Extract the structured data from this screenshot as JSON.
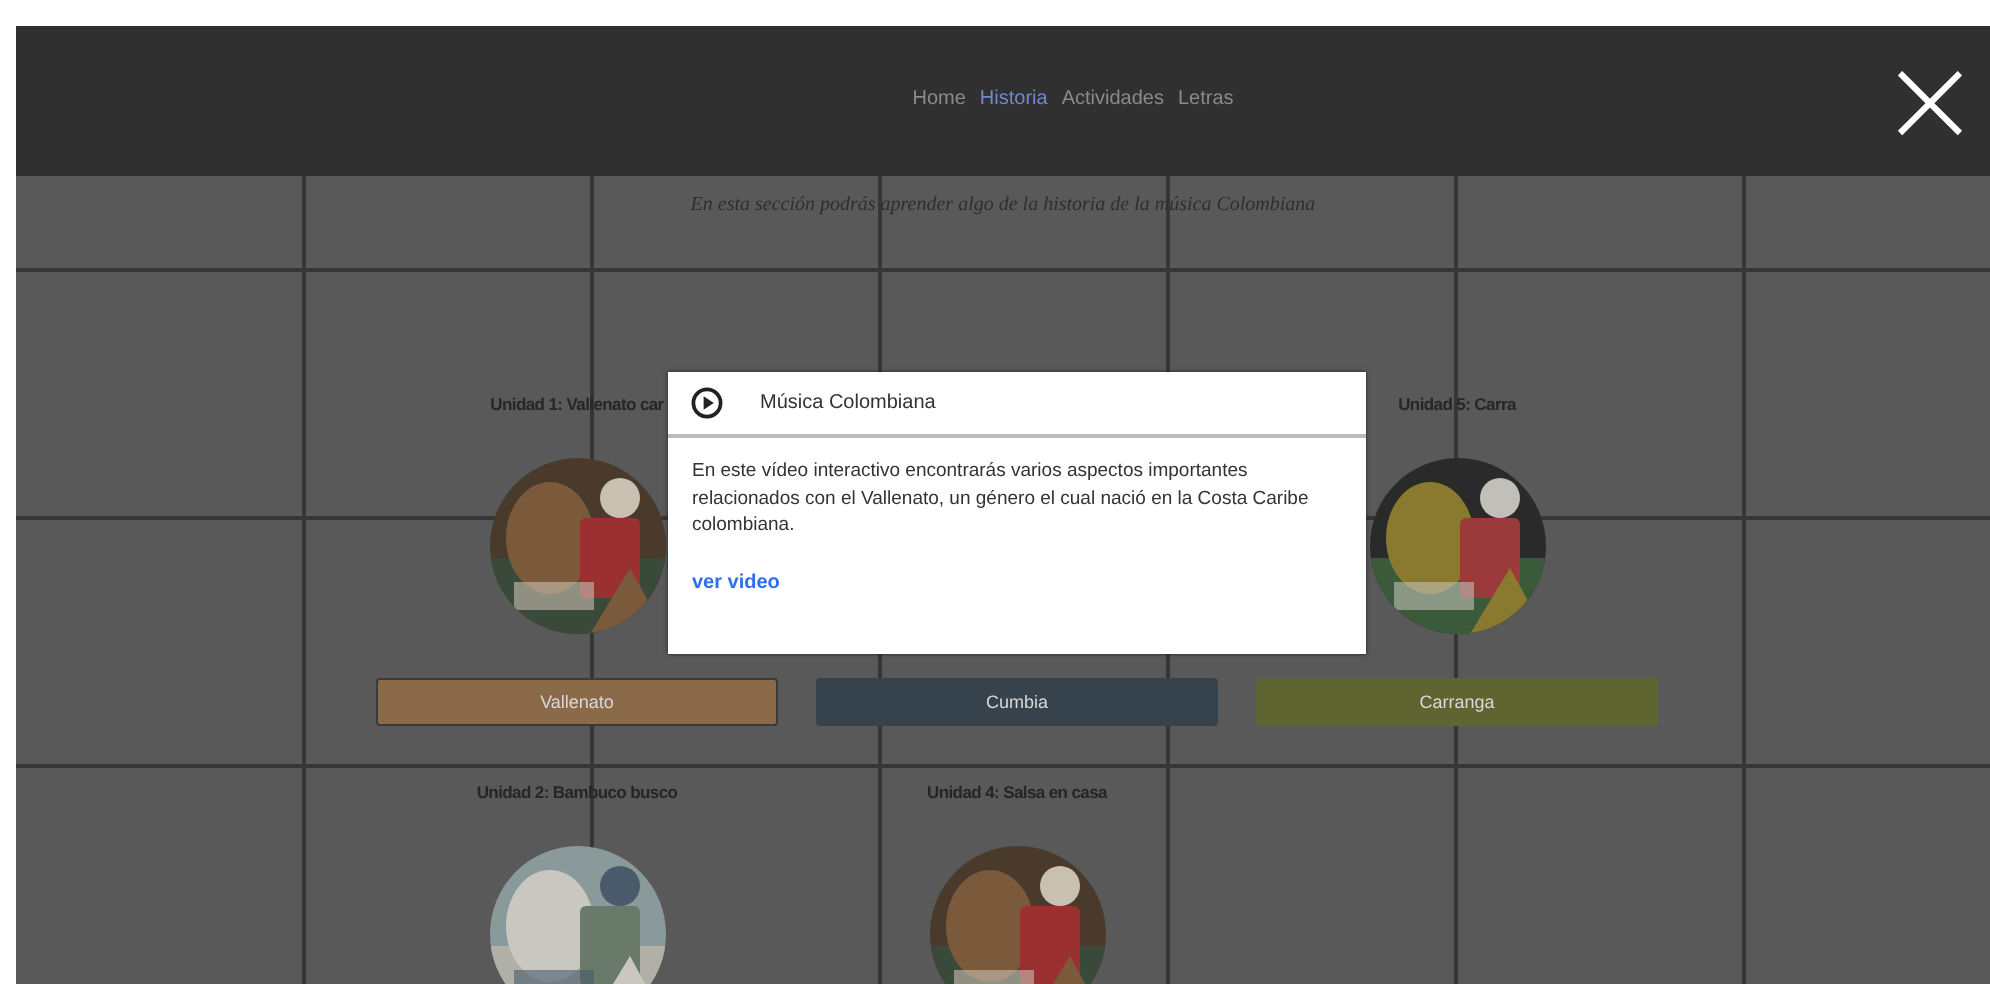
{
  "nav": {
    "items": [
      {
        "label": "Home",
        "selected": false
      },
      {
        "label": "Historia",
        "selected": true
      },
      {
        "label": "Actividades",
        "selected": false
      },
      {
        "label": "Letras",
        "selected": false
      }
    ]
  },
  "close_button": {
    "label": "×"
  },
  "subtitle": "En esta sección podrás aprender algo de la historia de la música Colombiana",
  "units": [
    {
      "title": "Unidad 1: Vallenato car",
      "button": {
        "label": "Vallenato",
        "selected": true,
        "color": "#8a6a48"
      }
    },
    {
      "button": {
        "label": "Cumbia",
        "selected": false,
        "color": "#36434c"
      }
    },
    {
      "title": "Unidad 5: Carra",
      "button": {
        "label": "Carranga",
        "selected": false,
        "color": "#5f6530"
      }
    },
    {
      "title": "Unidad 2: Bambuco busco"
    },
    {
      "title": "Unidad 4: Salsa en casa"
    }
  ],
  "modal": {
    "title": "Música Colombiana",
    "text": "En este vídeo interactivo encontrarás varios aspectos importantes relacionados con el Vallenato, un género el cual nació en la Costa Caribe colombiana.",
    "link": "ver video"
  }
}
